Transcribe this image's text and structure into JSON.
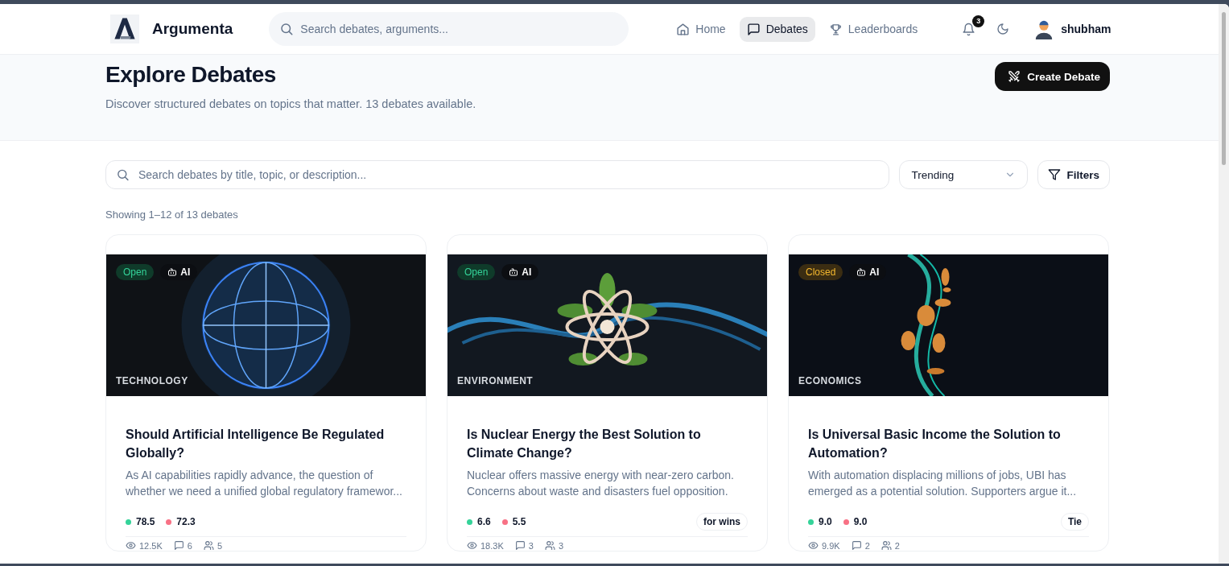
{
  "header": {
    "brand": "Argumenta",
    "search": {
      "placeholder": "Search debates, arguments..."
    },
    "nav": [
      {
        "label": "Home",
        "selected": false
      },
      {
        "label": "Debates",
        "selected": true
      },
      {
        "label": "Leaderboards",
        "selected": false
      }
    ],
    "notifications": "3",
    "user": "shubham"
  },
  "hero": {
    "title": "Explore Debates",
    "subtitle": "Discover structured debates on topics that matter. 13 debates available.",
    "create_button": "Create Debate"
  },
  "toolbar": {
    "search": {
      "placeholder": "Search debates by title, topic, or description..."
    },
    "sort": "Trending",
    "filters": "Filters"
  },
  "result_count": "Showing 1–12 of 13 debates",
  "cards": [
    {
      "status": {
        "label": "Open",
        "kind": "open"
      },
      "badge": "AI",
      "category": "TECHNOLOGY",
      "title": "Should Artificial Intelligence Be Regulated Globally?",
      "description": "As AI capabilities rapidly advance, the question of whether we need a unified global regulatory framewor...",
      "for_score": "78.5",
      "against_score": "72.3",
      "stats": {
        "views": "12.5K",
        "comments": "6",
        "participants": "5"
      }
    },
    {
      "status": {
        "label": "Open",
        "kind": "open"
      },
      "badge": "AI",
      "category": "ENVIRONMENT",
      "title": "Is Nuclear Energy the Best Solution to Climate Change?",
      "description": "Nuclear offers massive energy with near-zero carbon. Concerns about waste and disasters fuel opposition.",
      "for_score": "6.6",
      "against_score": "5.5",
      "verdict": "for wins",
      "stats": {
        "views": "18.3K",
        "comments": "3",
        "participants": "3"
      }
    },
    {
      "status": {
        "label": "Closed",
        "kind": "closed"
      },
      "badge": "AI",
      "category": "ECONOMICS",
      "title": "Is Universal Basic Income the Solution to Automation?",
      "description": "With automation displacing millions of jobs, UBI has emerged as a potential solution. Supporters argue it...",
      "for_score": "9.0",
      "against_score": "9.0",
      "verdict": "Tie",
      "stats": {
        "views": "9.9K",
        "comments": "2",
        "participants": "2"
      }
    }
  ]
}
